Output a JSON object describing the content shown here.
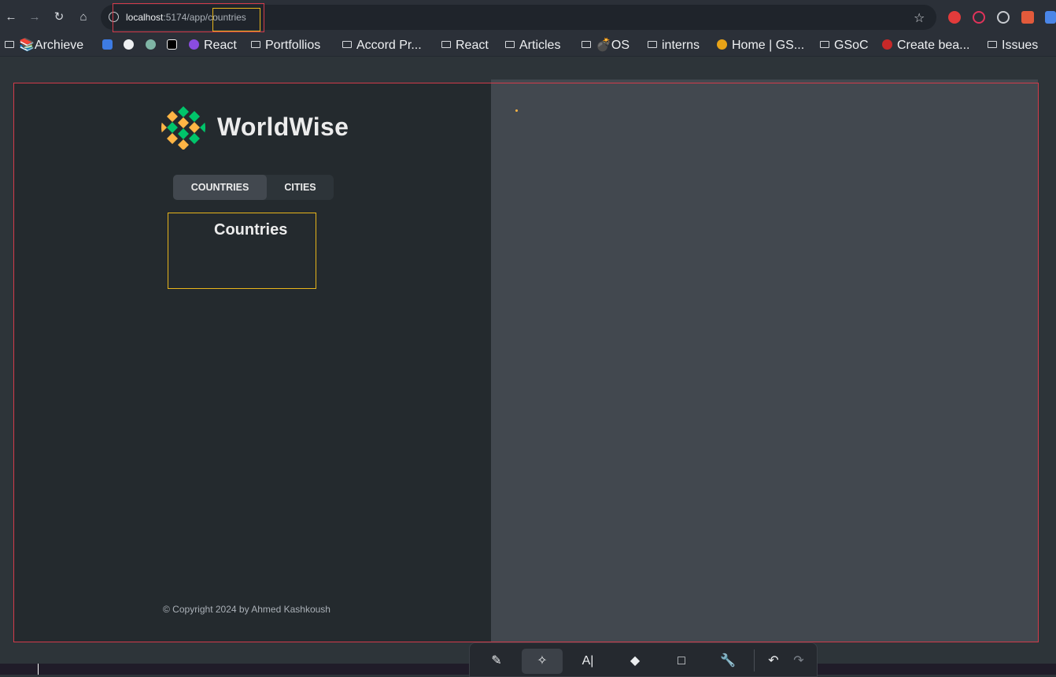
{
  "browser": {
    "url_host": "localhost",
    "url_rest": ":5174/app/countries",
    "bookmarks": [
      {
        "label": "📚Archieve",
        "icon": "folder"
      },
      {
        "label": "",
        "icon": "colored-square-blue"
      },
      {
        "label": "",
        "icon": "github-icon"
      },
      {
        "label": "",
        "icon": "openai-icon"
      },
      {
        "label": "",
        "icon": "p-icon"
      },
      {
        "label": "React",
        "icon": "purple-circle"
      },
      {
        "label": "Portfollios",
        "icon": "folder"
      },
      {
        "label": "Accord Pr...",
        "icon": "folder"
      },
      {
        "label": "React",
        "icon": "folder"
      },
      {
        "label": "Articles",
        "icon": "folder"
      },
      {
        "label": "💣OS",
        "icon": "folder"
      },
      {
        "label": "interns",
        "icon": "folder"
      },
      {
        "label": "Home | GS...",
        "icon": "gsoc-icon"
      },
      {
        "label": "GSoC",
        "icon": "folder"
      },
      {
        "label": "Create bea...",
        "icon": "red-dot-icon"
      },
      {
        "label": "Issues",
        "icon": "folder"
      }
    ]
  },
  "app": {
    "brand": "WorldWise",
    "tabs": [
      {
        "label": "Countries",
        "active": true
      },
      {
        "label": "Cities",
        "active": false
      }
    ],
    "list_title": "Countries",
    "footer": "© Copyright 2024 by Ahmed Kashkoush"
  },
  "colors": {
    "sidebar_bg": "#242a2e",
    "map_bg": "#42484f",
    "accent_orange": "#ffb545",
    "accent_green": "#00c46a",
    "highlight_red": "#d23b4a",
    "highlight_yellow": "#e7b51b"
  },
  "annotation_tools": [
    "brush-icon",
    "shapes-icon",
    "text-icon",
    "eraser-icon",
    "crop-icon",
    "wrench-icon",
    "undo-icon",
    "redo-icon"
  ]
}
